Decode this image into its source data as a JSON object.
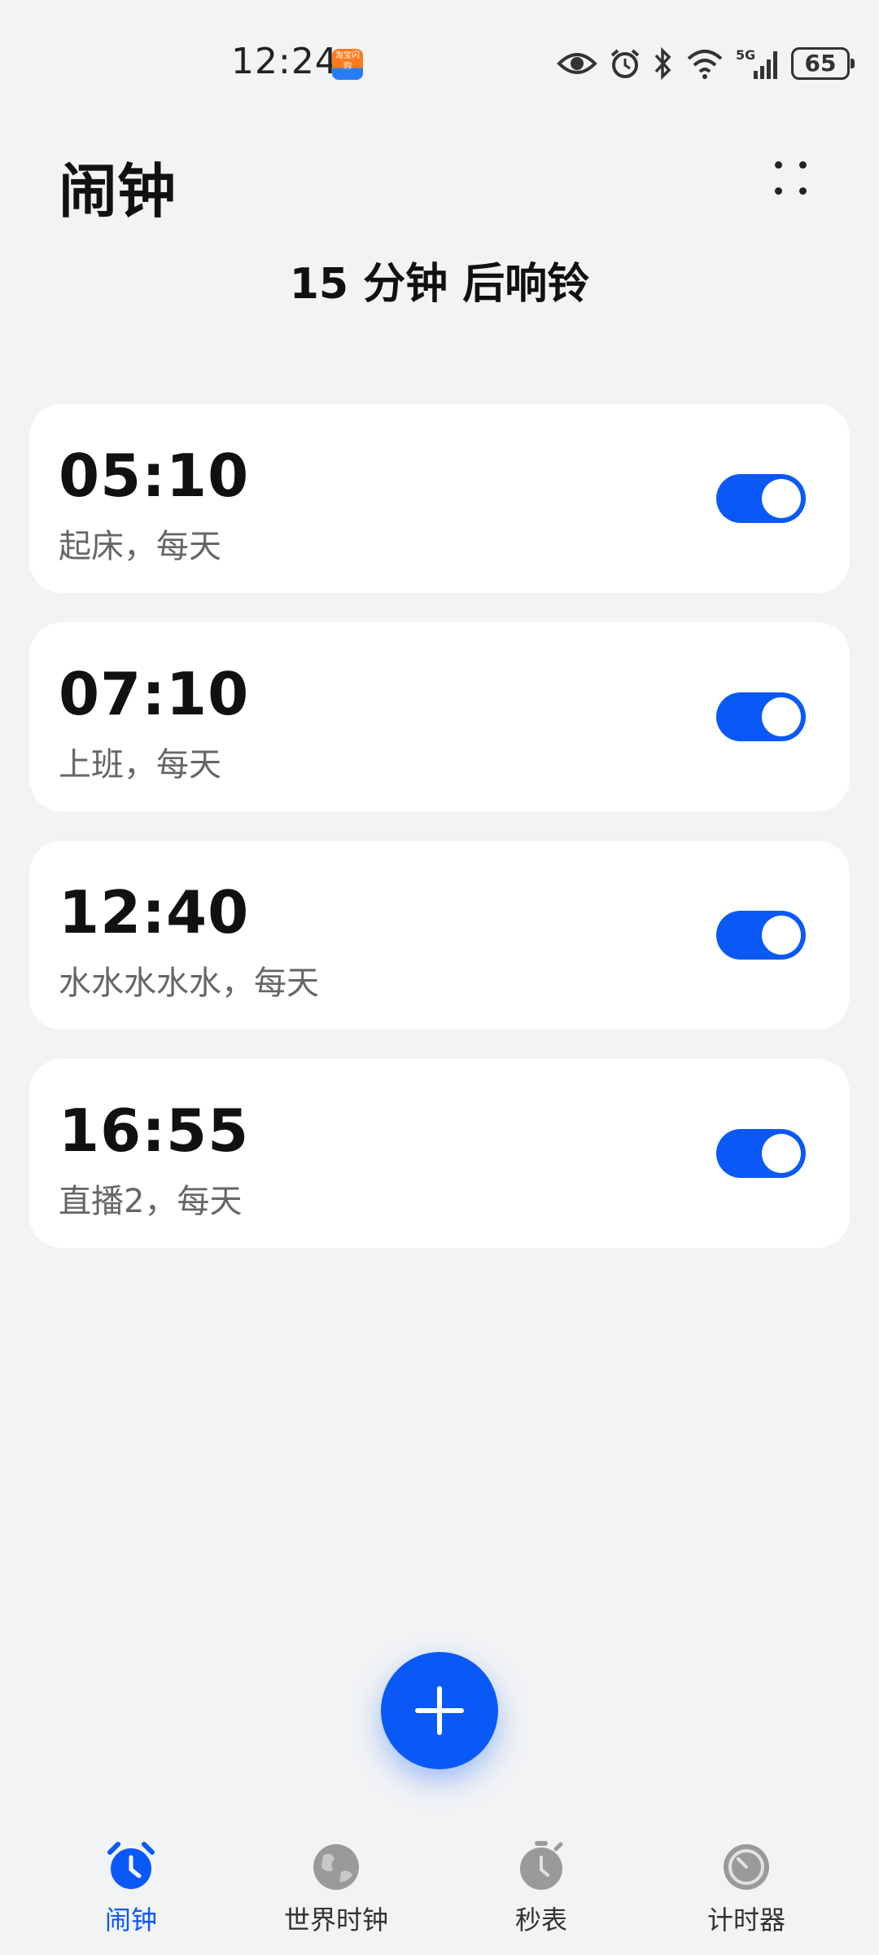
{
  "status_bar": {
    "time": "12:24",
    "app_badge": "淘宝闪购",
    "battery": "65",
    "network": "5G"
  },
  "header": {
    "title": "闹钟",
    "next_alarm": "15 分钟 后响铃"
  },
  "alarms": [
    {
      "time": "05:10",
      "label": "起床，每天",
      "enabled": true
    },
    {
      "time": "07:10",
      "label": "上班，每天",
      "enabled": true
    },
    {
      "time": "12:40",
      "label": "水水水水水，每天",
      "enabled": true
    },
    {
      "time": "16:55",
      "label": "直播2，每天",
      "enabled": true
    }
  ],
  "fab": {
    "icon": "plus-icon"
  },
  "bottom_nav": [
    {
      "label": "闹钟",
      "icon": "alarm-clock-icon",
      "active": true
    },
    {
      "label": "世界时钟",
      "icon": "globe-icon",
      "active": false
    },
    {
      "label": "秒表",
      "icon": "stopwatch-icon",
      "active": false
    },
    {
      "label": "计时器",
      "icon": "timer-icon",
      "active": false
    }
  ],
  "colors": {
    "accent": "#0a59f7",
    "background": "#f1f3f5",
    "card": "#ffffff",
    "inactive_icon": "#9a9a9a"
  }
}
